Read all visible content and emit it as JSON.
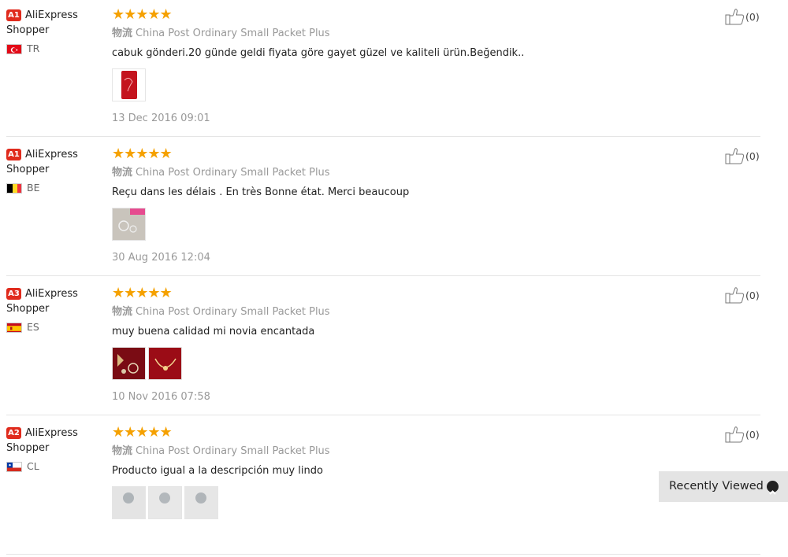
{
  "reviews": [
    {
      "level": "A1",
      "level_color": "#e02b1d",
      "user_first": "AliExpress",
      "user_second": "Shopper",
      "country": "TR",
      "flag": "turkey",
      "stars": "★★★★★",
      "logistics_label": "物流",
      "logistics_method": "China Post Ordinary Small Packet Plus",
      "text": "cabuk gönderi.20 günde geldi fiyata göre gayet güzel ve kaliteli ürün.Beğendik..",
      "photos": [
        "red-case-photo"
      ],
      "date": "13 Dec 2016 09:01",
      "helpful_count": "(0)"
    },
    {
      "level": "A1",
      "level_color": "#e02b1d",
      "user_first": "AliExpress",
      "user_second": "Shopper",
      "country": "BE",
      "flag": "belgium",
      "stars": "★★★★★",
      "logistics_label": "物流",
      "logistics_method": "China Post Ordinary Small Packet Plus",
      "text": "Reçu dans les délais . En très Bonne état. Merci beaucoup",
      "photos": [
        "silver-jewelry-photo"
      ],
      "date": "30 Aug 2016 12:04",
      "helpful_count": "(0)"
    },
    {
      "level": "A3",
      "level_color": "#e02b1d",
      "user_first": "AliExpress",
      "user_second": "Shopper",
      "country": "ES",
      "flag": "spain",
      "stars": "★★★★★",
      "logistics_label": "物流",
      "logistics_method": "China Post Ordinary Small Packet Plus",
      "text": "muy buena calidad mi novia encantada",
      "photos": [
        "red-box-earrings-photo",
        "red-box-necklace-photo"
      ],
      "date": "10 Nov 2016 07:58",
      "helpful_count": "(0)"
    },
    {
      "level": "A2",
      "level_color": "#e02b1d",
      "user_first": "AliExpress",
      "user_second": "Shopper",
      "country": "CL",
      "flag": "chile",
      "stars": "★★★★★",
      "logistics_label": "物流",
      "logistics_method": "China Post Ordinary Small Packet Plus",
      "text": "Producto igual a la descripción muy lindo",
      "photos": [
        "silver-item-photo-1",
        "silver-item-photo-2",
        "silver-item-photo-3"
      ],
      "date": "",
      "helpful_count": "(0)"
    }
  ],
  "recently_viewed": {
    "label": "Recently Viewed",
    "icon": "chevron-up-icon"
  },
  "colors": {
    "star": "#f5a100",
    "level_badge": "#e02b1d",
    "recent_bg": "#e4e4e4"
  }
}
